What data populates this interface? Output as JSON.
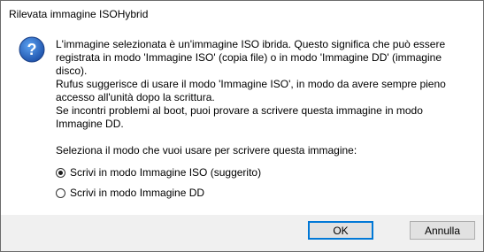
{
  "window": {
    "title": "Rilevata immagine ISOHybrid"
  },
  "dialog": {
    "icon": "question-icon",
    "message": "L'immagine selezionata è un'immagine ISO ibrida. Questo significa che può essere\nregistrata in modo 'Immagine ISO' (copia file) o in modo 'Immagine DD' (immagine\ndisco).\nRufus suggerisce di usare il modo 'Immagine ISO', in modo da avere sempre pieno\naccesso all'unità dopo la scrittura.\nSe incontri problemi al boot, puoi provare a scrivere questa immagine in modo\nImmagine DD.",
    "prompt": "Seleziona il modo che vuoi usare per scrivere questa immagine:",
    "options": [
      {
        "label": "Scrivi in modo Immagine ISO (suggerito)",
        "selected": true
      },
      {
        "label": "Scrivi in modo Immagine DD",
        "selected": false
      }
    ]
  },
  "buttons": {
    "ok": "OK",
    "cancel": "Annulla"
  },
  "colors": {
    "footer_bg": "#f0f0f0",
    "button_focus": "#0078d7",
    "icon_blue": "#1c63c4"
  }
}
